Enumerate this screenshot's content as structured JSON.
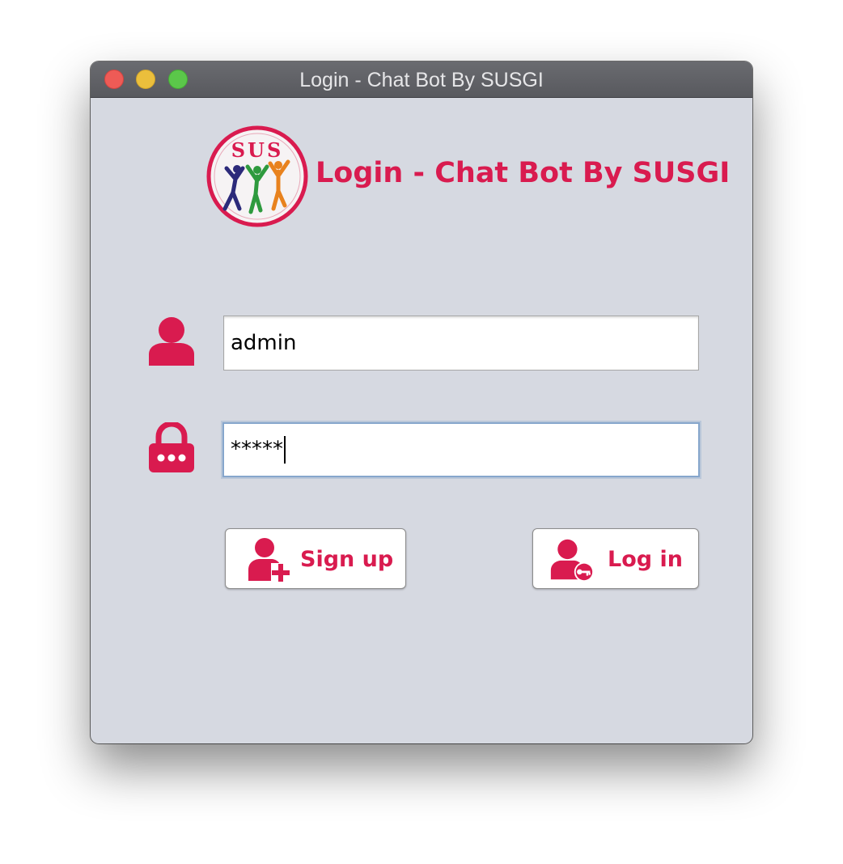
{
  "window": {
    "title": "Login - Chat Bot By SUSGI"
  },
  "header": {
    "title": "Login - Chat Bot By SUSGI",
    "logo_text": "SUS"
  },
  "form": {
    "username_value": "admin",
    "password_value": "*****"
  },
  "buttons": {
    "signup_label": "Sign up",
    "login_label": "Log in"
  },
  "colors": {
    "accent": "#d91b4f",
    "window_bg": "#d6d9e1",
    "titlebar": "#5f6065"
  },
  "icons": {
    "username": "user-icon",
    "password": "lock-icon",
    "signup": "add-user-icon",
    "login": "user-key-icon"
  }
}
